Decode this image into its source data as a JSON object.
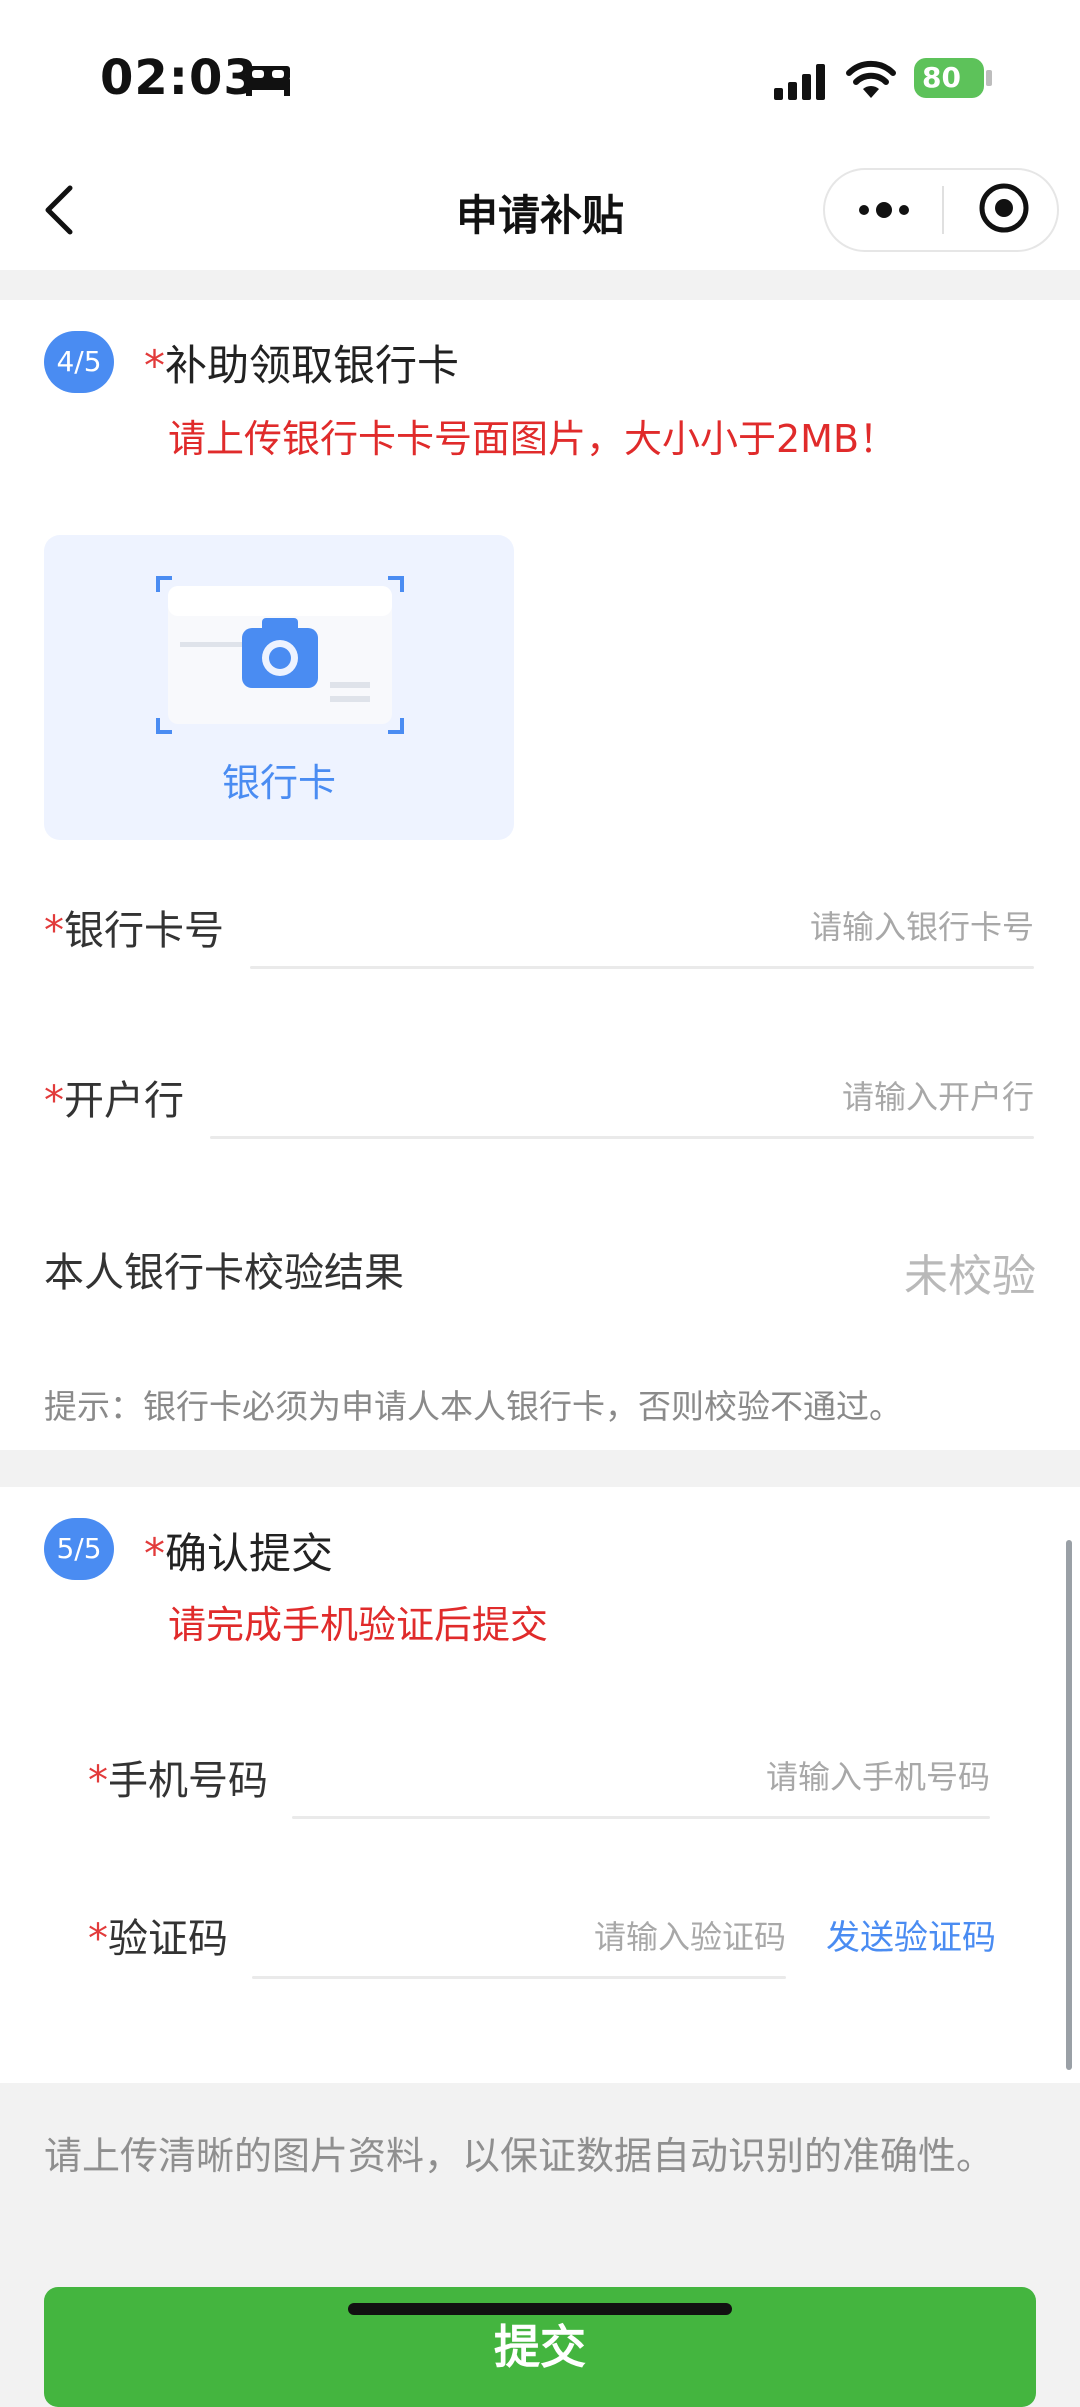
{
  "status_bar": {
    "time": "02:03",
    "battery": "80"
  },
  "nav": {
    "title": "申请补贴"
  },
  "section4": {
    "step": "4/5",
    "star": "*",
    "title": "补助领取银行卡",
    "hint": "请上传银行卡卡号面图片，大小小于2MB！",
    "upload_label": "银行卡",
    "card_number": {
      "label": "银行卡号",
      "placeholder": "请输入银行卡号"
    },
    "bank": {
      "label": "开户行",
      "placeholder": "请输入开户行"
    },
    "verify": {
      "label": "本人银行卡校验结果",
      "status": "未校验"
    },
    "tip": "提示：银行卡必须为申请人本人银行卡，否则校验不通过。"
  },
  "section5": {
    "step": "5/5",
    "star": "*",
    "title": "确认提交",
    "hint": "请完成手机验证后提交",
    "phone": {
      "label": "手机号码",
      "placeholder": "请输入手机号码"
    },
    "code": {
      "label": "验证码",
      "placeholder": "请输入验证码",
      "send_label": "发送验证码"
    }
  },
  "footer": {
    "tip": "请上传清晰的图片资料，以保证数据自动识别的准确性。",
    "submit_label": "提交"
  },
  "colors": {
    "accent": "#4a8cf2",
    "danger": "#e02b2b",
    "submit": "#44b53f"
  }
}
